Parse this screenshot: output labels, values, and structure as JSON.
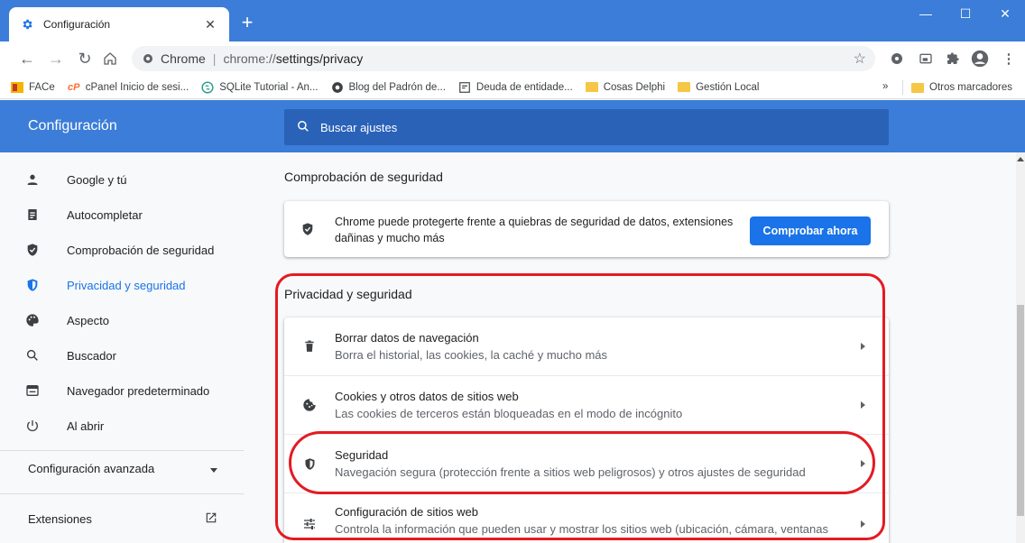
{
  "browser": {
    "tab_title": "Configuración",
    "new_tab": "+",
    "window_controls": {
      "minimize": "—",
      "maximize": "☐",
      "close": "✕"
    },
    "omnibox": {
      "site": "Chrome",
      "url_host": "chrome://",
      "url_path": "settings/privacy"
    },
    "bookmarks": [
      {
        "label": "FACe",
        "icon": "face-logo-icon"
      },
      {
        "label": "cPanel Inicio de sesi...",
        "icon": "cpanel-icon"
      },
      {
        "label": "SQLite Tutorial - An...",
        "icon": "sqlite-icon"
      },
      {
        "label": "Blog del Padrón de...",
        "icon": "blog-icon"
      },
      {
        "label": "Deuda de entidade...",
        "icon": "document-icon"
      },
      {
        "label": "Cosas Delphi",
        "icon": "folder-icon"
      },
      {
        "label": "Gestión Local",
        "icon": "folder-icon"
      }
    ],
    "bookmarks_overflow": "»",
    "other_bookmarks": "Otros marcadores"
  },
  "settings": {
    "title": "Configuración",
    "search_placeholder": "Buscar ajustes"
  },
  "sidebar": {
    "items": [
      {
        "label": "Google y tú",
        "icon": "person-icon"
      },
      {
        "label": "Autocompletar",
        "icon": "clipboard-icon"
      },
      {
        "label": "Comprobación de seguridad",
        "icon": "shield-check-icon"
      },
      {
        "label": "Privacidad y seguridad",
        "icon": "shield-icon",
        "active": true
      },
      {
        "label": "Aspecto",
        "icon": "palette-icon"
      },
      {
        "label": "Buscador",
        "icon": "search-icon"
      },
      {
        "label": "Navegador predeterminado",
        "icon": "browser-icon"
      },
      {
        "label": "Al abrir",
        "icon": "power-icon"
      }
    ],
    "advanced": "Configuración avanzada",
    "extensions": "Extensiones"
  },
  "main": {
    "safety_check": {
      "title": "Comprobación de seguridad",
      "text_line1": "Chrome puede protegerte frente a quiebras de seguridad de datos, extensiones",
      "text_line2": "dañinas y mucho más",
      "button": "Comprobar ahora"
    },
    "privacy": {
      "title": "Privacidad y seguridad",
      "rows": [
        {
          "primary": "Borrar datos de navegación",
          "secondary": "Borra el historial, las cookies, la caché y mucho más",
          "icon": "trash-icon"
        },
        {
          "primary": "Cookies y otros datos de sitios web",
          "secondary": "Las cookies de terceros están bloqueadas en el modo de incógnito",
          "icon": "cookie-icon"
        },
        {
          "primary": "Seguridad",
          "secondary": "Navegación segura (protección frente a sitios web peligrosos) y otros ajustes de seguridad",
          "icon": "shield-icon"
        },
        {
          "primary": "Configuración de sitios web",
          "secondary": "Controla la información que pueden usar y mostrar los sitios web (ubicación, cámara, ventanas",
          "icon": "sliders-icon"
        }
      ]
    }
  },
  "colors": {
    "accent": "#1a73e8",
    "header": "#3b7dd8",
    "annotation": "#e31b23"
  }
}
